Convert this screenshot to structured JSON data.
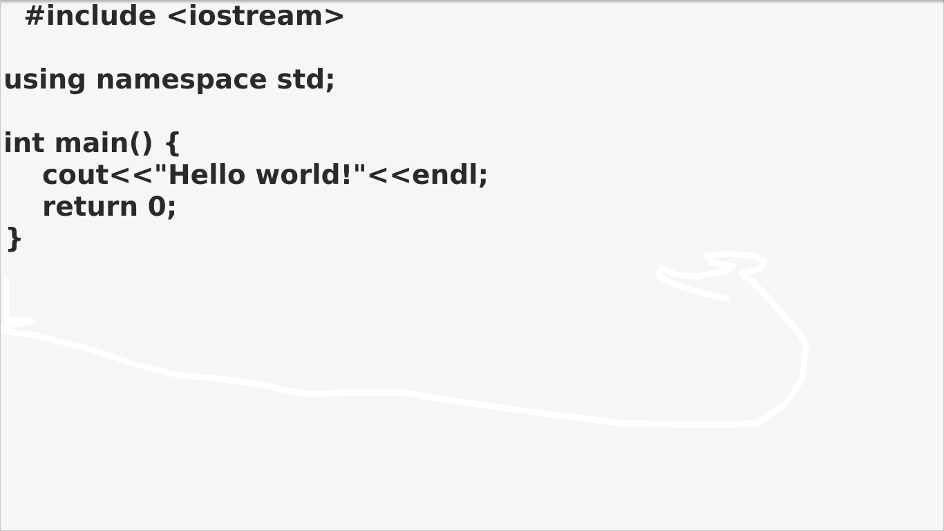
{
  "editor": {
    "code_lines": [
      "#include <iostream>",
      "using namespace std;",
      "int main() {",
      "cout<<\"Hello world!\"<<endl;",
      "return 0;",
      "}"
    ]
  },
  "colors": {
    "background": "#f6f6f6",
    "text": "#2a2a2a",
    "ink": "#ffffff"
  }
}
